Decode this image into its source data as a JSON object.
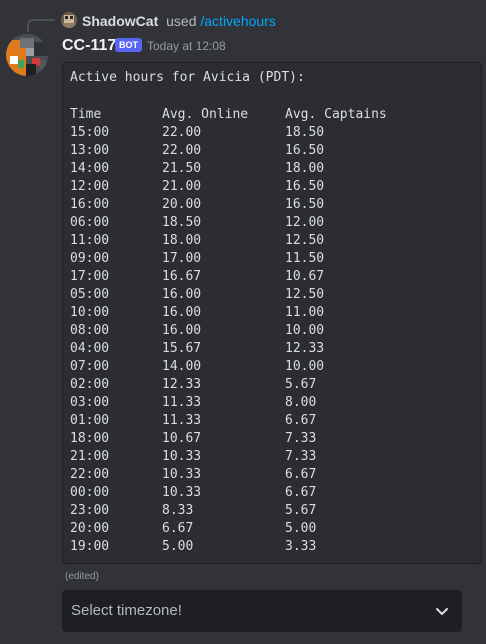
{
  "reply": {
    "username": "ShadowCat",
    "used_text": "used",
    "command": "/activehours"
  },
  "message": {
    "author": "CC-117",
    "bot_tag": "BOT",
    "timestamp": "Today at 12:08",
    "edited": "(edited)"
  },
  "code": {
    "title": "Active hours for Avicia (PDT):",
    "headers": [
      "Time",
      "Avg. Online",
      "Avg. Captains"
    ],
    "rows": [
      [
        "15:00",
        "22.00",
        "18.50"
      ],
      [
        "13:00",
        "22.00",
        "16.50"
      ],
      [
        "14:00",
        "21.50",
        "18.00"
      ],
      [
        "12:00",
        "21.00",
        "16.50"
      ],
      [
        "16:00",
        "20.00",
        "16.50"
      ],
      [
        "06:00",
        "18.50",
        "12.00"
      ],
      [
        "11:00",
        "18.00",
        "12.50"
      ],
      [
        "09:00",
        "17.00",
        "11.50"
      ],
      [
        "17:00",
        "16.67",
        "10.67"
      ],
      [
        "05:00",
        "16.00",
        "12.50"
      ],
      [
        "10:00",
        "16.00",
        "11.00"
      ],
      [
        "08:00",
        "16.00",
        "10.00"
      ],
      [
        "04:00",
        "15.67",
        "12.33"
      ],
      [
        "07:00",
        "14.00",
        "10.00"
      ],
      [
        "02:00",
        "12.33",
        "5.67"
      ],
      [
        "03:00",
        "11.33",
        "8.00"
      ],
      [
        "01:00",
        "11.33",
        "6.67"
      ],
      [
        "18:00",
        "10.67",
        "7.33"
      ],
      [
        "21:00",
        "10.33",
        "7.33"
      ],
      [
        "22:00",
        "10.33",
        "6.67"
      ],
      [
        "00:00",
        "10.33",
        "6.67"
      ],
      [
        "23:00",
        "8.33",
        "5.67"
      ],
      [
        "20:00",
        "6.67",
        "5.00"
      ],
      [
        "19:00",
        "5.00",
        "3.33"
      ]
    ]
  },
  "select": {
    "placeholder": "Select timezone!"
  },
  "colors": {
    "background": "#313338",
    "codeblock": "#2b2d31",
    "bot_tag": "#5865f2",
    "command_link": "#00a8fc"
  }
}
